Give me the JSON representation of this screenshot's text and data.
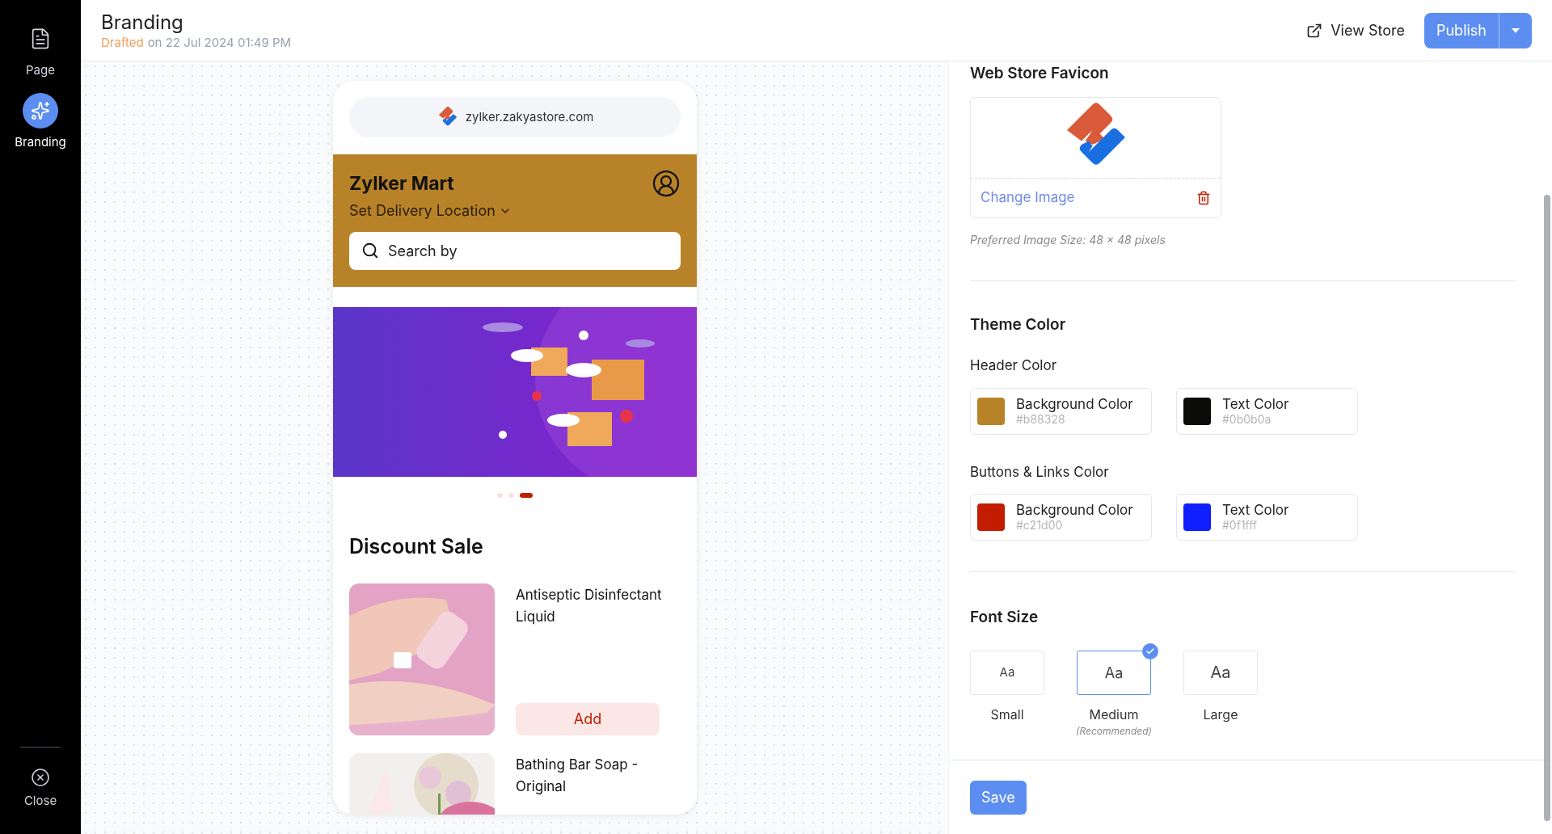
{
  "sidebar": {
    "items": [
      {
        "label": "Page",
        "selected": false
      },
      {
        "label": "Branding",
        "selected": true
      }
    ],
    "close_label": "Close"
  },
  "header": {
    "title": "Branding",
    "status": "Drafted",
    "timestamp": "on 22 Jul 2024 01:49 PM",
    "view_store": "View Store",
    "publish": "Publish"
  },
  "preview": {
    "url": "zylker.zakyastore.com",
    "store_name": "Zylker Mart",
    "delivery_location": "Set Delivery Location",
    "search_placeholder": "Search by",
    "carousel_dots": [
      {
        "selected": false
      },
      {
        "selected": false
      },
      {
        "selected": true
      }
    ],
    "section_title": "Discount Sale",
    "products": [
      {
        "name": "Antiseptic Disinfectant Liquid",
        "button": "Add"
      },
      {
        "name": "Bathing Bar Soap - Original"
      }
    ]
  },
  "settings": {
    "favicon": {
      "title": "Web Store Favicon",
      "change_label": "Change Image",
      "hint": "Preferred Image Size: 48 × 48 pixels"
    },
    "theme": {
      "title": "Theme Color",
      "groups": [
        {
          "label": "Header Color",
          "swatches": [
            {
              "label": "Background Color",
              "value": "#b88328",
              "color": "#b88328"
            },
            {
              "label": "Text Color",
              "value": "#0b0b0a",
              "color": "#0b0b0a"
            }
          ]
        },
        {
          "label": "Buttons & Links Color",
          "swatches": [
            {
              "label": "Background Color",
              "value": "#c21d00",
              "color": "#c21d00"
            },
            {
              "label": "Text Color",
              "value": "#0f1fff",
              "color": "#0f1fff"
            }
          ]
        }
      ]
    },
    "font_size": {
      "title": "Font Size",
      "options": [
        {
          "sample": "Aa",
          "label": "Small",
          "selected": false
        },
        {
          "sample": "Aa",
          "label": "Medium",
          "note": "(Recommended)",
          "selected": true
        },
        {
          "sample": "Aa",
          "label": "Large",
          "selected": false
        }
      ]
    },
    "save": "Save"
  }
}
